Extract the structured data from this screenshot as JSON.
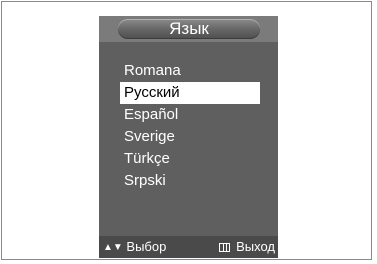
{
  "menu": {
    "title": "Язык",
    "items": [
      {
        "label": "Romana",
        "selected": false
      },
      {
        "label": "Русский",
        "selected": true
      },
      {
        "label": "Español",
        "selected": false
      },
      {
        "label": "Sverige",
        "selected": false
      },
      {
        "label": "Türkçe",
        "selected": false
      },
      {
        "label": "Srpski",
        "selected": false
      }
    ]
  },
  "footer": {
    "move_label": "Выбор",
    "move_icon": "up-down-arrows-icon",
    "move_glyph": "▲▼",
    "exit_label": "Выход",
    "exit_icon": "menu-exit-icon"
  },
  "colors": {
    "panel": "#5f5f5f",
    "title_bar": "#7b7b7b",
    "highlight": "#ffffff",
    "footer": "#4a4a4a"
  }
}
